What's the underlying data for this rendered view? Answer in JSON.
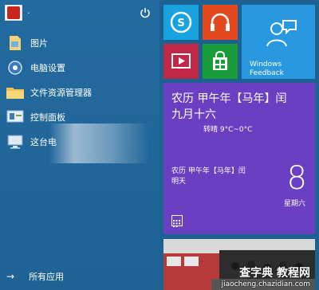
{
  "user": {
    "name": "·"
  },
  "menu": [
    {
      "id": "pictures",
      "label": "图片",
      "icon": "folder-pictures-icon"
    },
    {
      "id": "settings",
      "label": "电脑设置",
      "icon": "gear-icon"
    },
    {
      "id": "explorer",
      "label": "文件资源管理器",
      "icon": "folder-explorer-icon"
    },
    {
      "id": "control-panel",
      "label": "控制面板",
      "icon": "control-panel-icon"
    },
    {
      "id": "this-pc",
      "label": "这台电",
      "icon": "computer-icon"
    }
  ],
  "all_apps": {
    "arrow": "→",
    "label": "所有应用"
  },
  "tiles": {
    "feedback": {
      "label_line1": "Windows",
      "label_line2": "Feedback"
    },
    "calendar": {
      "lunar_line1": "农历 甲午年【马年】闰",
      "lunar_line2": "九月十六",
      "weather": "转晴 9°C~0°C",
      "small_line1": "农历 甲午年【马年】闰",
      "small_line2": "明天",
      "day": "8",
      "weekday": "星期六"
    }
  },
  "watermark": {
    "line1": "查字典 教程网",
    "line2": "jiaocheng.chazidian.com"
  },
  "colors": {
    "start_bg": "#236a9e",
    "skype": "#18a2e0",
    "music": "#e4481f",
    "video": "#c12747",
    "store": "#1a9c3b",
    "feedback": "#2899e0",
    "calendar": "#6b3fc2"
  }
}
